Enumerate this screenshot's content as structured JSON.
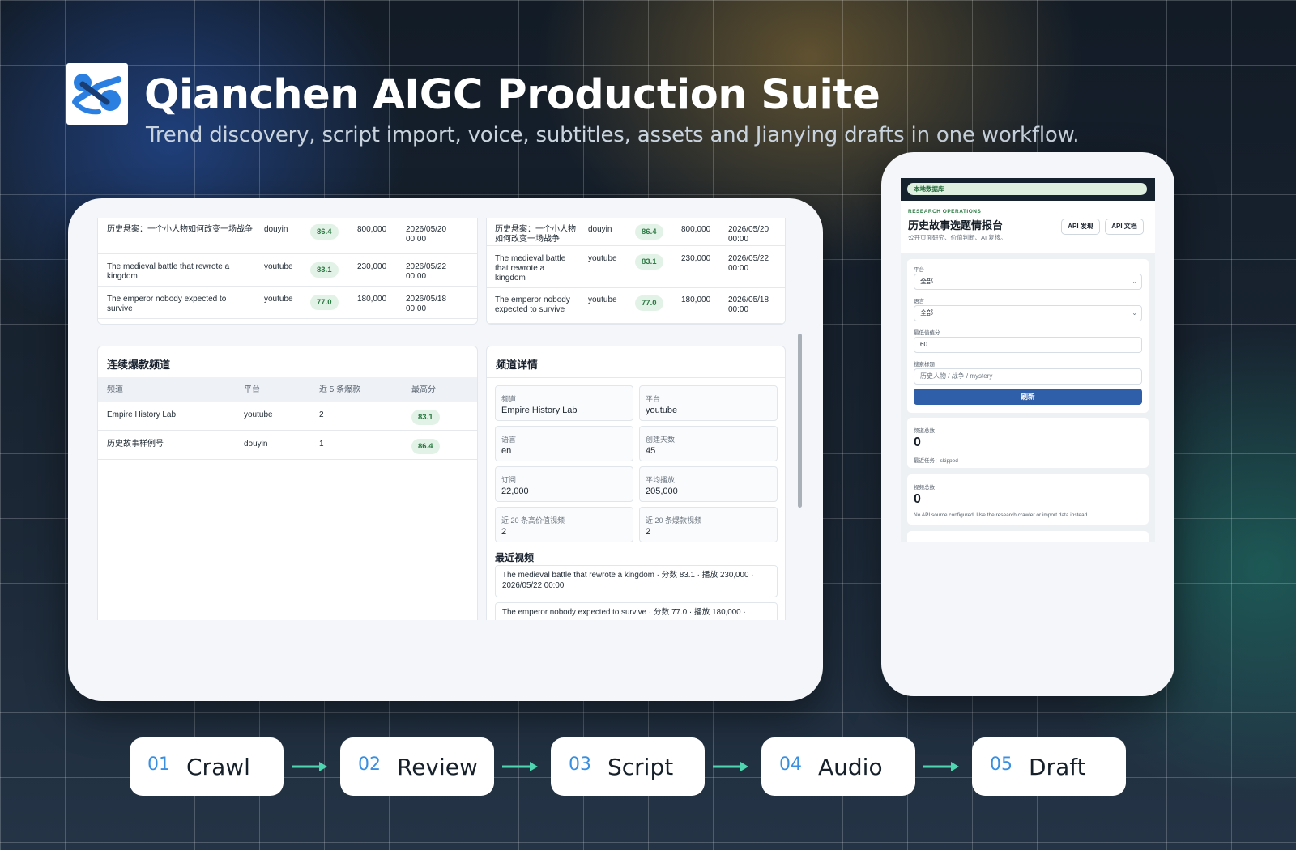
{
  "header": {
    "title": "Qianchen AIGC Production Suite",
    "subtitle": "Trend discovery, script import, voice, subtitles, assets and Jianying drafts in one workflow."
  },
  "colors": {
    "accent": "#3b8fe0",
    "score_bg": "#e3f2e6",
    "score_text": "#2b7a43",
    "primary_button": "#2f5fa8"
  },
  "tablet": {
    "top_left_rows": [
      {
        "title": "历史悬案：一个小人物如何改变一场战争",
        "platform": "douyin",
        "score": "86.4",
        "plays": "800,000",
        "date": "2026/05/20 00:00"
      },
      {
        "title": "The medieval battle that rewrote a kingdom",
        "platform": "youtube",
        "score": "83.1",
        "plays": "230,000",
        "date": "2026/05/22 00:00"
      },
      {
        "title": "The emperor nobody expected to survive",
        "platform": "youtube",
        "score": "77.0",
        "plays": "180,000",
        "date": "2026/05/18 00:00"
      }
    ],
    "top_right_rows": [
      {
        "title": "历史悬案：一个小人物如何改变一场战争",
        "platform": "douyin",
        "score": "86.4",
        "plays": "800,000",
        "date": "2026/05/20 00:00"
      },
      {
        "title": "The medieval battle that rewrote a kingdom",
        "platform": "youtube",
        "score": "83.1",
        "plays": "230,000",
        "date": "2026/05/22 00:00"
      },
      {
        "title": "The emperor nobody expected to survive",
        "platform": "youtube",
        "score": "77.0",
        "plays": "180,000",
        "date": "2026/05/18 00:00"
      }
    ],
    "channels": {
      "title": "连续爆款频道",
      "columns": [
        "频道",
        "平台",
        "近 5 条爆款",
        "最高分"
      ],
      "rows": [
        {
          "channel": "Empire History Lab",
          "platform": "youtube",
          "hits": "2",
          "best": "83.1"
        },
        {
          "channel": "历史故事样例号",
          "platform": "douyin",
          "hits": "1",
          "best": "86.4"
        }
      ]
    },
    "detail": {
      "title": "频道详情",
      "fields": [
        {
          "label": "频道",
          "value": "Empire History Lab"
        },
        {
          "label": "平台",
          "value": "youtube"
        },
        {
          "label": "语言",
          "value": "en"
        },
        {
          "label": "创建天数",
          "value": "45"
        },
        {
          "label": "订阅",
          "value": "22,000"
        },
        {
          "label": "平均播放",
          "value": "205,000"
        },
        {
          "label": "近 20 条高价值视频",
          "value": "2"
        },
        {
          "label": "近 20 条爆款视频",
          "value": "2"
        }
      ],
      "recent_title": "最近视频",
      "recent": [
        "The medieval battle that rewrote a kingdom · 分数 83.1 · 播放 230,000 · 2026/05/22 00:00",
        "The emperor nobody expected to survive · 分数 77.0 · 播放 180,000 ·"
      ]
    }
  },
  "phone": {
    "chip": "本地数据库",
    "eyebrow": "RESEARCH OPERATIONS",
    "title": "历史故事选题情报台",
    "desc": "公开页面研究、价值判断、AI 复核。",
    "btn_api_discover": "API 发现",
    "btn_api_docs": "API 文档",
    "filters": {
      "platform_label": "平台",
      "platform_value": "全部",
      "language_label": "语言",
      "language_value": "全部",
      "min_score_label": "最低值值分",
      "min_score_value": "60",
      "search_label": "搜索标题",
      "search_placeholder": "历史人物 / 战争 / mystery",
      "refresh": "刷新"
    },
    "stats": [
      {
        "label": "频道总数",
        "value": "0",
        "note": "最近任务：skipped"
      },
      {
        "label": "视频总数",
        "value": "0",
        "note": "No API source configured. Use the research crawler or import data instead."
      }
    ]
  },
  "steps": [
    {
      "num": "01",
      "label": "Crawl"
    },
    {
      "num": "02",
      "label": "Review"
    },
    {
      "num": "03",
      "label": "Script"
    },
    {
      "num": "04",
      "label": "Audio"
    },
    {
      "num": "05",
      "label": "Draft"
    }
  ]
}
